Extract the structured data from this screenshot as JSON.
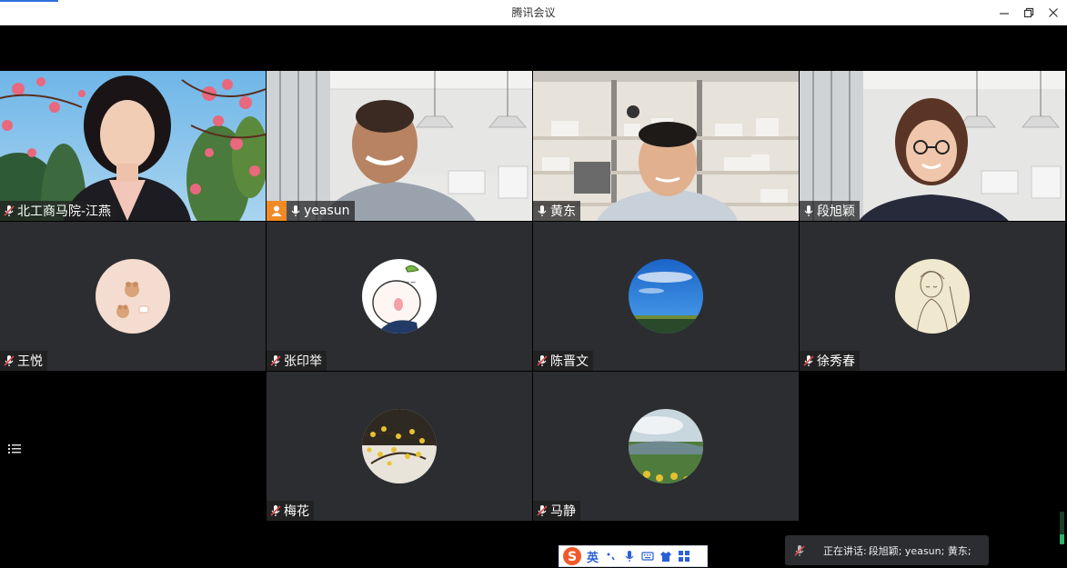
{
  "window": {
    "title": "腾讯会议"
  },
  "participants": [
    {
      "name": "北工商马院-江燕",
      "type": "video",
      "muted": true
    },
    {
      "name": "yeasun",
      "type": "video",
      "muted": false,
      "host": true
    },
    {
      "name": "黄东",
      "type": "video",
      "muted": false
    },
    {
      "name": "段旭颖",
      "type": "video",
      "muted": false,
      "active": true
    },
    {
      "name": "王悦",
      "type": "avatar",
      "muted": true
    },
    {
      "name": "张印举",
      "type": "avatar",
      "muted": true
    },
    {
      "name": "陈晋文",
      "type": "avatar",
      "muted": true
    },
    {
      "name": "徐秀春",
      "type": "avatar",
      "muted": true
    },
    {
      "name": "梅花",
      "type": "avatar",
      "muted": true
    },
    {
      "name": "马静",
      "type": "avatar",
      "muted": true
    }
  ],
  "speaking": {
    "label": "正在讲话:",
    "names": "段旭颖; yeasun; 黄东;"
  },
  "ime": {
    "lang": "英"
  },
  "colors": {
    "host_badge": "#f08a24",
    "active_border": "#2fb36a",
    "tile_bg": "#2b2d30"
  }
}
